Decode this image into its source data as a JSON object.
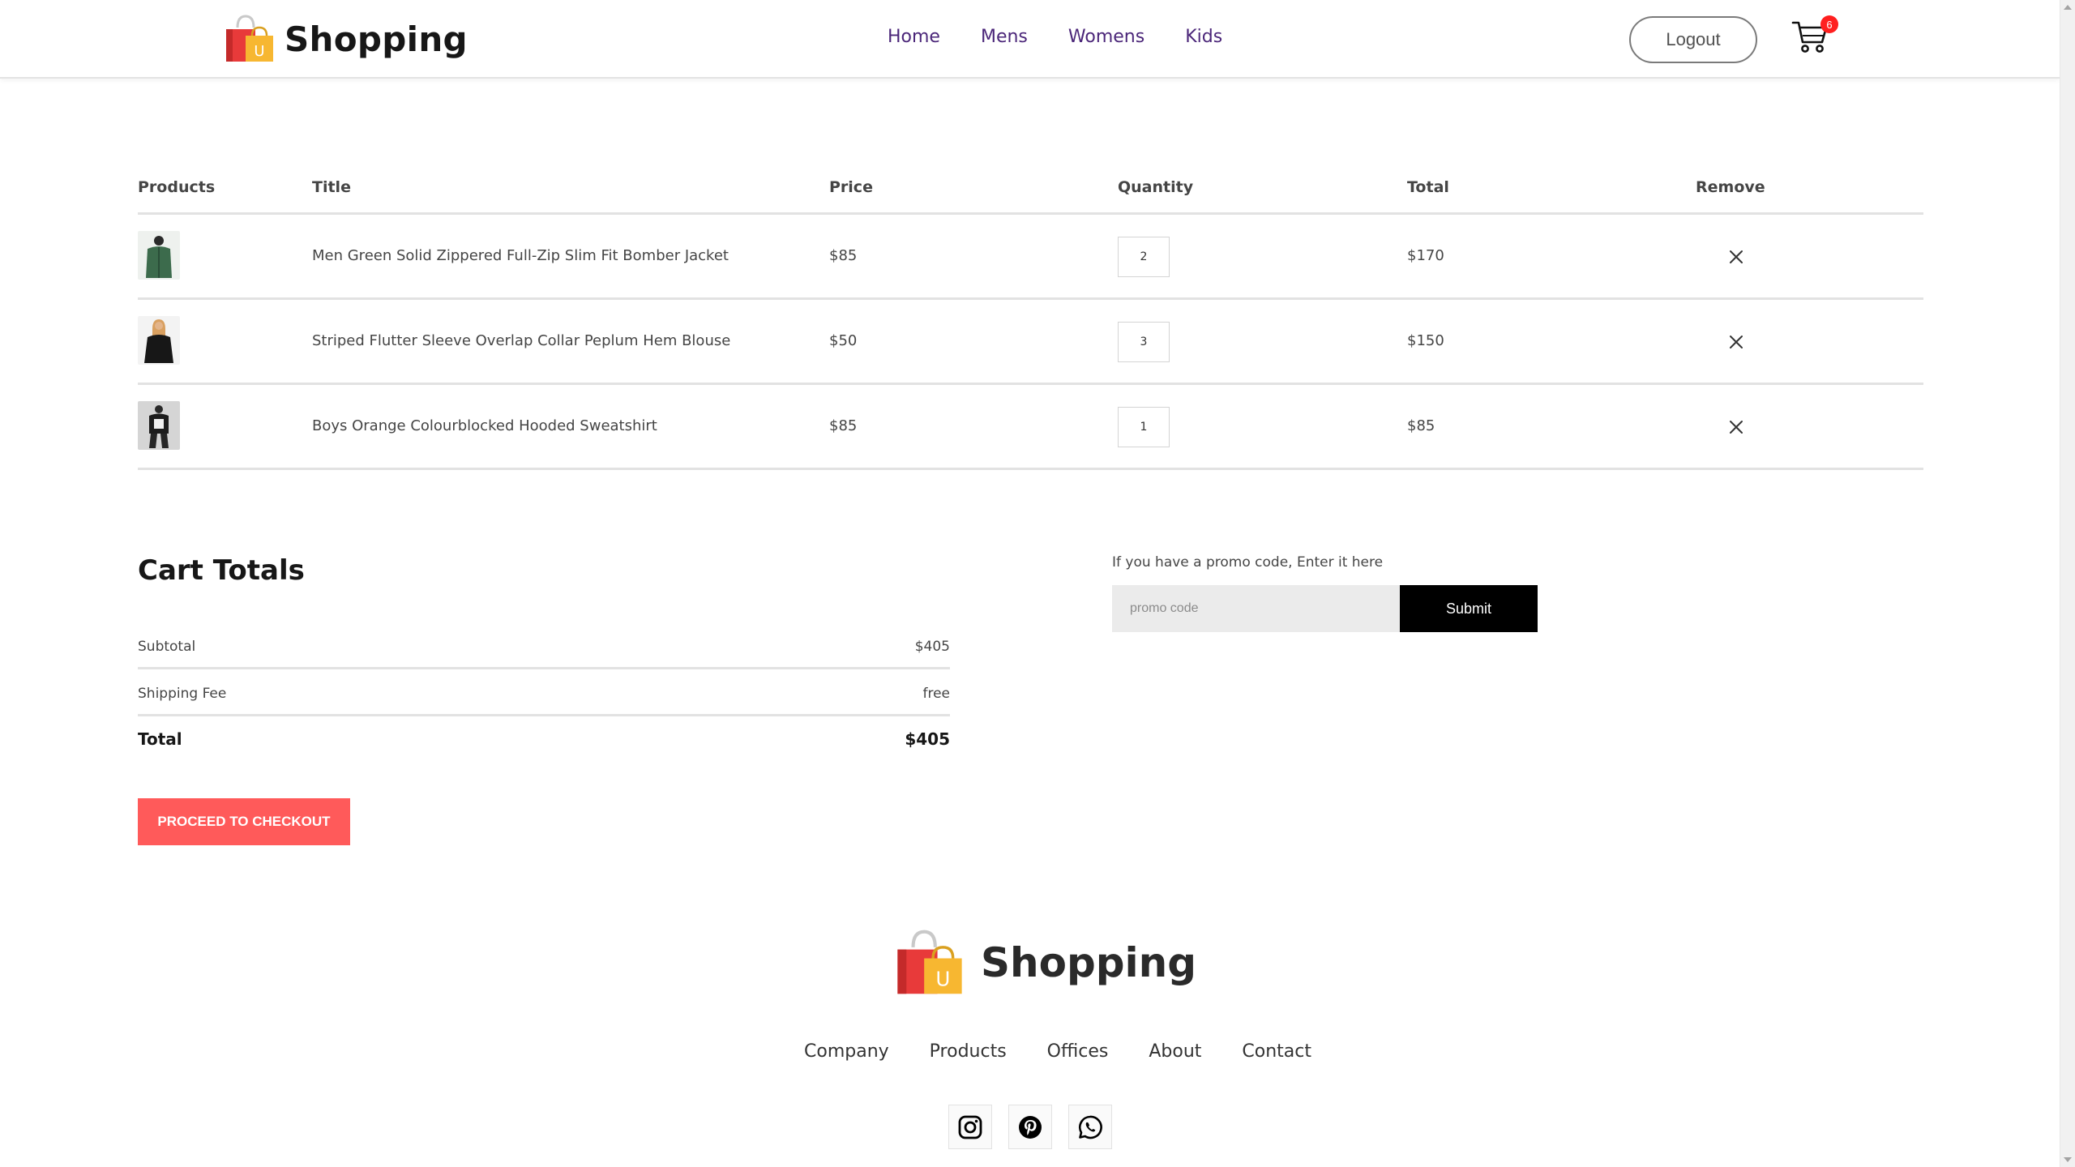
{
  "header": {
    "brand": "Shopping",
    "nav": [
      "Home",
      "Mens",
      "Womens",
      "Kids"
    ],
    "logout_label": "Logout",
    "cart_count": "6"
  },
  "cart": {
    "columns": [
      "Products",
      "Title",
      "Price",
      "Quantity",
      "Total",
      "Remove"
    ],
    "items": [
      {
        "title": "Men Green Solid Zippered Full-Zip Slim Fit Bomber Jacket",
        "price": "$85",
        "quantity": "2",
        "total": "$170"
      },
      {
        "title": "Striped Flutter Sleeve Overlap Collar Peplum Hem Blouse",
        "price": "$50",
        "quantity": "3",
        "total": "$150"
      },
      {
        "title": "Boys Orange Colourblocked Hooded Sweatshirt",
        "price": "$85",
        "quantity": "1",
        "total": "$85"
      }
    ]
  },
  "totals": {
    "title": "Cart Totals",
    "subtotal_label": "Subtotal",
    "subtotal_value": "$405",
    "shipping_label": "Shipping Fee",
    "shipping_value": "free",
    "total_label": "Total",
    "total_value": "$405",
    "checkout_label": "PROCEED TO CHECKOUT"
  },
  "promo": {
    "label": "If you have a promo code, Enter it here",
    "placeholder": "promo code",
    "submit_label": "Submit"
  },
  "footer": {
    "brand": "Shopping",
    "links": [
      "Company",
      "Products",
      "Offices",
      "About",
      "Contact"
    ],
    "social": [
      "instagram-icon",
      "pinterest-icon",
      "whatsapp-icon"
    ]
  },
  "colors": {
    "nav_link": "#4b2679",
    "checkout_button": "#ff5a5a",
    "badge": "#ff1f1f",
    "submit_button": "#000000"
  }
}
